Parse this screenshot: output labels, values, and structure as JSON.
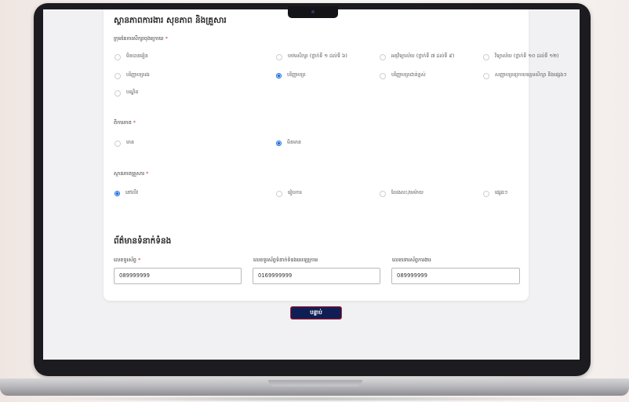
{
  "form": {
    "health_section_title": "ស្ថានភាពការងារ សុខភាព និងគ្រួសារ",
    "education": {
      "label": "ក្រុមនៃការសិក្សាចុងក្រោយ",
      "required_mark": "*",
      "options": [
        {
          "label": "មិនបានរៀន",
          "selected": false
        },
        {
          "label": "បឋមសិក្សា (ថ្នាក់ទី ១ ដល់ទី ៦)",
          "selected": false
        },
        {
          "label": "អនុវិទ្យាល័យ (ថ្នាក់ទី ៧ ដល់ទី ៩)",
          "selected": false
        },
        {
          "label": "វិទ្យាល័យ (ថ្នាក់ទី ១០ ដល់ទី ១២)",
          "selected": false
        },
        {
          "label": "បរិញ្ញាបត្ររង",
          "selected": false
        },
        {
          "label": "បរិញ្ញាបត្រ",
          "selected": true
        },
        {
          "label": "បរិញ្ញាបត្រជាន់ខ្ពស់",
          "selected": false
        },
        {
          "label": "សញ្ញាបត្រក្រោយឧត្តមសិក្សា និងផ្សេងៗ",
          "selected": false
        },
        {
          "label": "បណ្ឌិត",
          "selected": false
        }
      ]
    },
    "disability": {
      "label": "ពិការភាព",
      "required_mark": "*",
      "options": [
        {
          "label": "មាន",
          "selected": false
        },
        {
          "label": "មិនមាន",
          "selected": true
        }
      ]
    },
    "marital": {
      "label": "ស្ថានភាពគ្រួសារ",
      "required_mark": "*",
      "options": [
        {
          "label": "នៅលីវ",
          "selected": true
        },
        {
          "label": "រៀបការ",
          "selected": false
        },
        {
          "label": "លែងលះ/មេម៉ាយ",
          "selected": false
        },
        {
          "label": "ផ្សេងៗ",
          "selected": false
        }
      ]
    },
    "contact_section_title": "ព័ត៌មានទំនាក់ទំនង",
    "contact": {
      "phone": {
        "label": "លេខទូរស័ព្ទ",
        "required_mark": "*",
        "value": "089999999"
      },
      "telegram": {
        "label": "លេខទូរស័ព្ទទំនាក់ទំនងតេឡេក្រាម",
        "value": "0169999999"
      },
      "other_phone": {
        "label": "លេខទោរស័ព្ទការងារ",
        "value": "089999999"
      }
    }
  },
  "next_button_label": "បន្ទាប់",
  "colors": {
    "accent": "#1d6fe0",
    "button_bg": "#0f1f55",
    "button_border": "#c42436",
    "required": "#d3362b"
  }
}
